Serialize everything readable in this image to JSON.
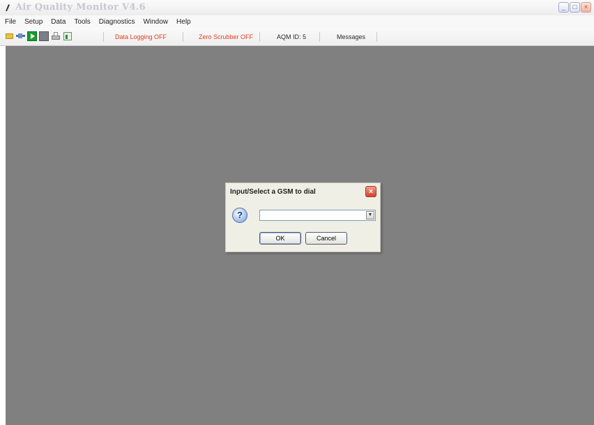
{
  "window": {
    "title": "Air Quality Monitor V4.6",
    "controls": {
      "minimize": "_",
      "maximize": "□",
      "close": "×"
    }
  },
  "menu": {
    "items": [
      {
        "label": "File"
      },
      {
        "label": "Setup"
      },
      {
        "label": "Data"
      },
      {
        "label": "Tools"
      },
      {
        "label": "Diagnostics"
      },
      {
        "label": "Window"
      },
      {
        "label": "Help"
      }
    ]
  },
  "toolbar": {
    "icons": [
      "open-icon",
      "connect-icon",
      "start-icon",
      "stop-icon",
      "print-icon",
      "chart-icon"
    ],
    "status": {
      "data_logging": "Data Logging OFF",
      "zero_scrubber": "Zero Scrubber OFF",
      "aqm_id": "AQM ID: 5",
      "messages": "Messages"
    },
    "status_colors": {
      "off": "#e53b1a",
      "normal": "#2a2a2a"
    }
  },
  "workspace": {
    "background": "#808080"
  },
  "dialog": {
    "title": "Input/Select a GSM to dial",
    "close": "×",
    "icon": "question-icon",
    "combo_value": "",
    "combo_arrow": "▼",
    "ok_label": "OK",
    "cancel_label": "Cancel"
  }
}
